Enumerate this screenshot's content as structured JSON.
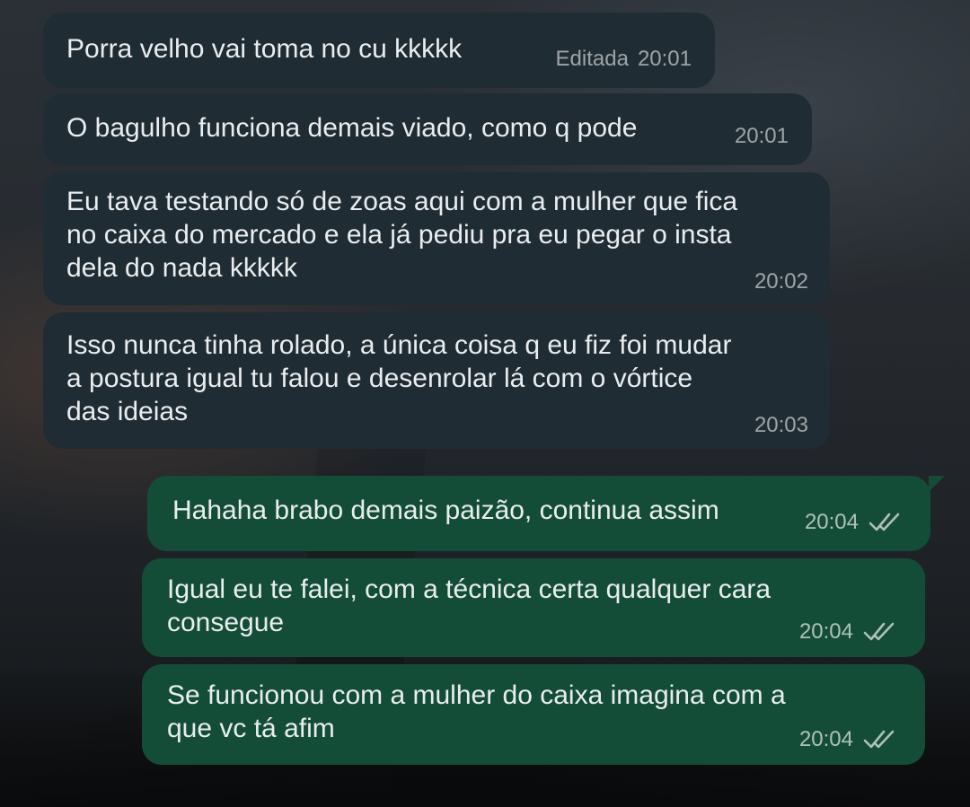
{
  "messages": [
    {
      "direction": "incoming",
      "text": "Porra velho vai toma no cu kkkkk",
      "edited_label": "Editada",
      "time": "20:01"
    },
    {
      "direction": "incoming",
      "text": "O bagulho funciona demais viado, como q pode",
      "time": "20:01"
    },
    {
      "direction": "incoming",
      "text": "Eu tava testando só de zoas aqui com a mulher que fica\nno caixa do mercado e ela já pediu pra eu pegar o insta\ndela do nada kkkkk",
      "time": "20:02"
    },
    {
      "direction": "incoming",
      "text": "Isso nunca tinha rolado, a única coisa q eu fiz foi mudar\na postura igual tu falou e desenrolar lá com o vórtice\ndas ideias",
      "time": "20:03"
    },
    {
      "direction": "outgoing",
      "text": "Hahaha brabo demais paizão, continua assim",
      "time": "20:04",
      "status_icon": "double-check-icon"
    },
    {
      "direction": "outgoing",
      "text": "Igual eu te falei, com a técnica certa qualquer cara\nconsegue",
      "time": "20:04",
      "status_icon": "double-check-icon"
    },
    {
      "direction": "outgoing",
      "text": "Se funcionou com a mulher do caixa imagina com a\nque vc tá afim",
      "time": "20:04",
      "status_icon": "double-check-icon"
    }
  ],
  "colors": {
    "incoming_bubble": "#202c33",
    "outgoing_bubble": "#144d37",
    "text": "#e9edef"
  }
}
